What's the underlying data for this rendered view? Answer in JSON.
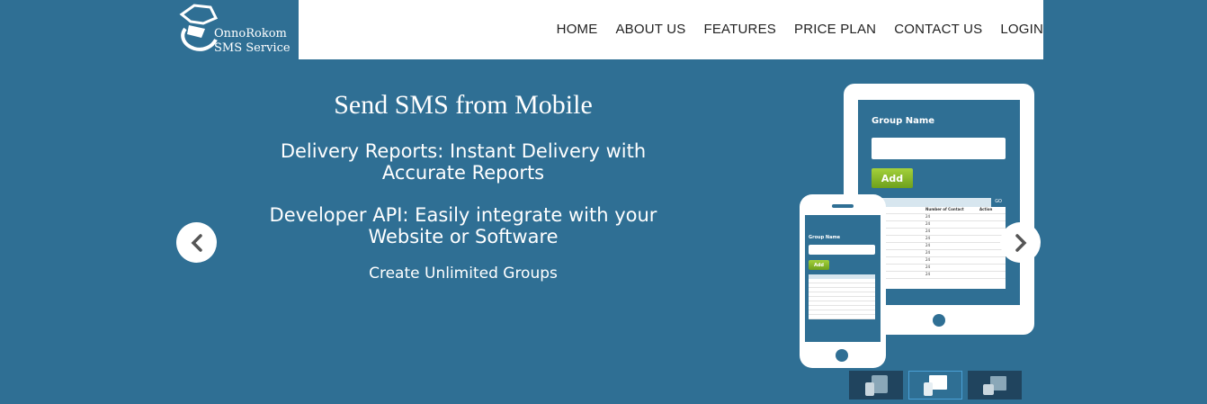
{
  "brand": {
    "line1": "OnnoRokom",
    "line2": "SMS Service"
  },
  "nav": {
    "items": [
      "HOME",
      "ABOUT US",
      "FEATURES",
      "PRICE PLAN",
      "CONTACT US",
      "LOGIN"
    ]
  },
  "hero": {
    "title": "Send SMS from Mobile",
    "line1a": "Delivery Reports: Instant Delivery with",
    "line1b": "Accurate Reports",
    "line2a": "Developer API: Easily integrate with your",
    "line2b": "Website or Software",
    "line3": "Create Unlimited Groups"
  },
  "device": {
    "group_label": "Group Name",
    "add_label": "Add",
    "go_label": "GO",
    "col_name": "Name",
    "col_contact": "Number of Contact",
    "col_action": "Action",
    "contact_value": "24"
  },
  "slider": {
    "prev_icon": "chevron-left-icon",
    "next_icon": "chevron-right-icon",
    "active_index": 1
  },
  "colors": {
    "background": "#2f6f94",
    "button_green": "#7fb52a",
    "header": "#ffffff"
  }
}
